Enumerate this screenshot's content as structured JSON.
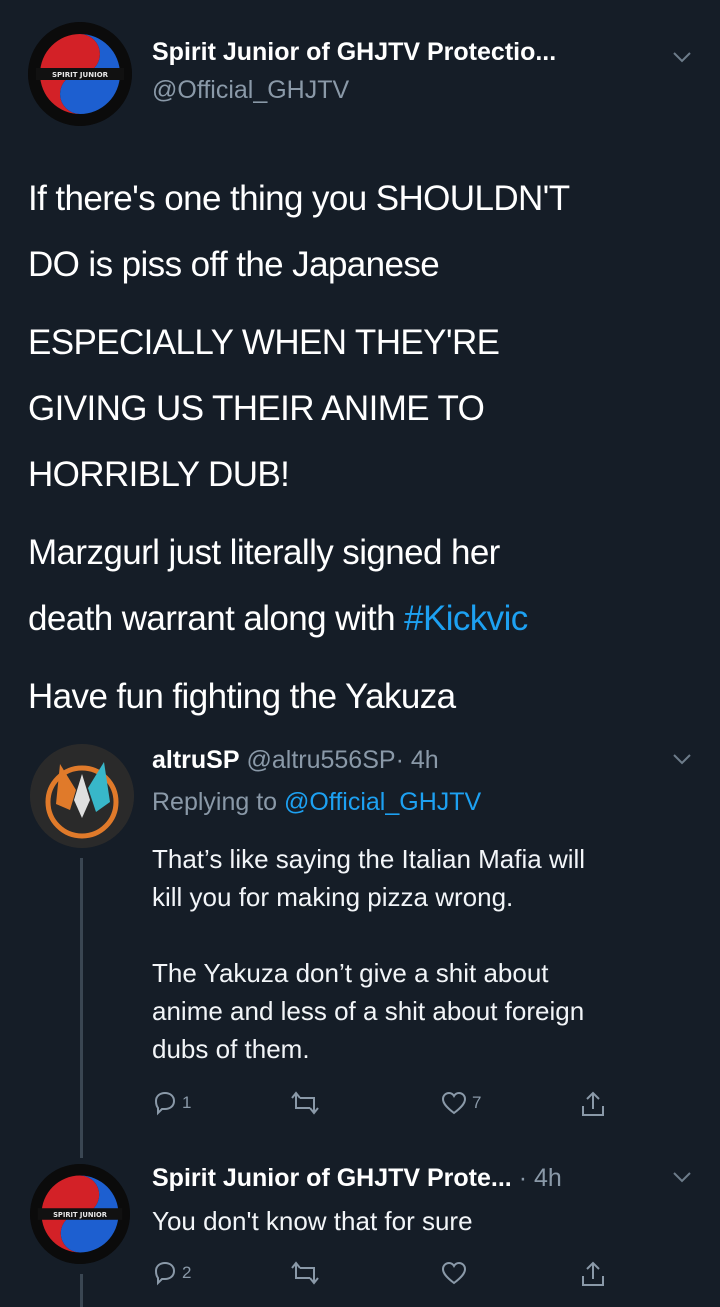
{
  "main_tweet": {
    "display_name": "Spirit Junior of GHJTV Protectio...",
    "handle": "@Official_GHJTV",
    "avatar_text": "SPIRIT JUNIOR",
    "paragraphs": {
      "p1": {
        "line1": "If there's one thing you SHOULDN'T",
        "line2": "DO is piss off the Japanese"
      },
      "p2": {
        "line1": "ESPECIALLY WHEN THEY'RE",
        "line2": "GIVING US THEIR ANIME TO",
        "line3": "HORRIBLY DUB!"
      },
      "p3": {
        "line1": "Marzgurl just literally signed her",
        "line2_prefix": "death warrant along with ",
        "hashtag": "#Kickvic"
      },
      "p4": {
        "line1": "Have fun fighting the Yakuza"
      }
    }
  },
  "reply_1": {
    "display_name": "altruSP",
    "handle": "@altru556SP",
    "time": "· 4h",
    "replying_prefix": "Replying to ",
    "replying_handle": "@Official_GHJTV",
    "text": {
      "l1": "That’s like saying the Italian Mafia will",
      "l2": "kill you for making pizza wrong.",
      "l3": "The Yakuza don’t give a shit about",
      "l4": "anime and less of a shit about foreign",
      "l5": "dubs of them."
    },
    "reply_count": "1",
    "like_count": "7"
  },
  "reply_2": {
    "display_name": "Spirit Junior of GHJTV Prote...",
    "time": "· 4h",
    "avatar_text": "SPIRIT JUNIOR",
    "text": "You don't know that for sure",
    "reply_count": "2"
  },
  "colors": {
    "background": "#151d27",
    "link": "#1da1f2",
    "muted": "#8a99a8",
    "avatar_red": "#d32127",
    "avatar_blue": "#1d5fd0"
  },
  "icons": [
    "chevron-down-icon",
    "reply-icon",
    "retweet-icon",
    "like-icon",
    "share-icon"
  ]
}
